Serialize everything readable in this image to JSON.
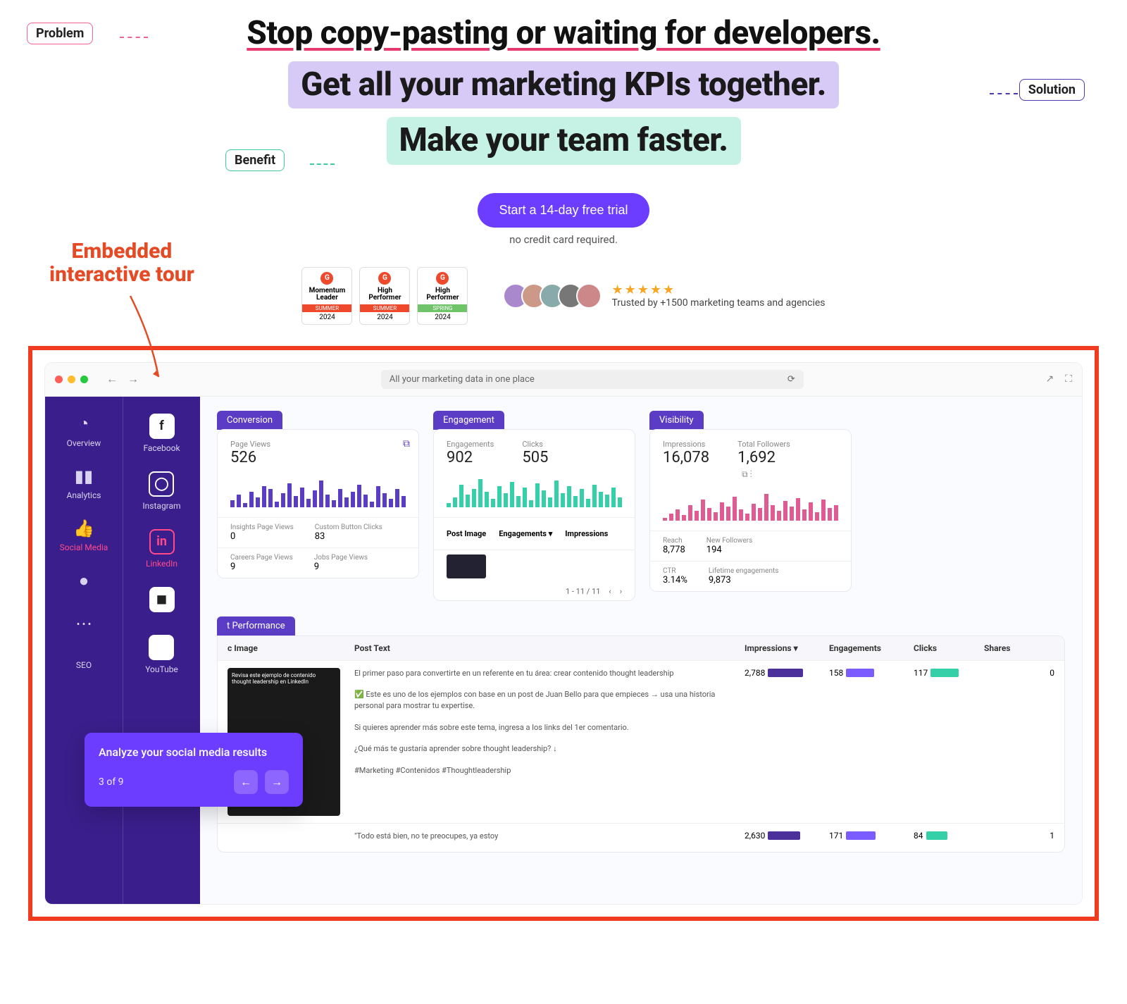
{
  "tags": {
    "problem": "Problem",
    "solution": "Solution",
    "benefit": "Benefit"
  },
  "headline": {
    "line1": "Stop copy-pasting or waiting for developers.",
    "line2": "Get all your marketing KPIs together.",
    "line3": "Make your team faster."
  },
  "cta": {
    "button": "Start a 14-day free trial",
    "sub": "no credit card required."
  },
  "annotation": "Embedded\ninteractive tour",
  "badges": [
    {
      "title": "Momentum Leader",
      "season": "SUMMER",
      "year": "2024",
      "variant": "summer"
    },
    {
      "title": "High Performer",
      "season": "SUMMER",
      "year": "2024",
      "variant": "summer"
    },
    {
      "title": "High Performer",
      "season": "SPRING",
      "year": "2024",
      "variant": "spring"
    }
  ],
  "trusted": {
    "stars": "★★★★★",
    "text": "Trusted by +1500 marketing teams and agencies"
  },
  "browser": {
    "title": "All your marketing data in one place"
  },
  "sidebar1": [
    {
      "icon": "◔",
      "label": "Overview",
      "name": "overview"
    },
    {
      "icon": "▮▮",
      "label": "Analytics",
      "name": "analytics"
    },
    {
      "icon": "👍",
      "label": "Social Media",
      "name": "social-media",
      "pink": true
    },
    {
      "icon": "●",
      "label": "",
      "name": "dot1"
    },
    {
      "icon": "⋯",
      "label": "",
      "name": "dot2"
    },
    {
      "icon": "",
      "label": "SEO",
      "name": "seo"
    }
  ],
  "sidebar2": [
    {
      "glyph": "f",
      "label": "Facebook",
      "name": "facebook"
    },
    {
      "glyph": "◯",
      "label": "Instagram",
      "name": "instagram",
      "outline": true
    },
    {
      "glyph": "in",
      "label": "LinkedIn",
      "name": "linkedin",
      "pink": true
    },
    {
      "glyph": "◼",
      "label": "",
      "name": "twitter"
    },
    {
      "glyph": "",
      "label": "YouTube",
      "name": "youtube"
    }
  ],
  "cards": {
    "conversion": {
      "tab": "Conversion",
      "kpis": [
        {
          "label": "Page Views",
          "value": "526"
        }
      ],
      "bars": [
        10,
        18,
        6,
        22,
        14,
        30,
        26,
        8,
        20,
        34,
        16,
        28,
        12,
        24,
        38,
        18,
        10,
        26,
        14,
        22,
        32,
        18,
        8,
        30,
        20,
        12,
        26,
        16
      ],
      "rows": [
        [
          {
            "l": "Insights Page Views",
            "v": "0"
          },
          {
            "l": "Custom Button Clicks",
            "v": "83"
          }
        ],
        [
          {
            "l": "Careers Page Views",
            "v": "9"
          },
          {
            "l": "Jobs Page Views",
            "v": "9"
          }
        ]
      ]
    },
    "engagement": {
      "tab": "Engagement",
      "kpis": [
        {
          "label": "Engagements",
          "value": "902"
        },
        {
          "label": "Clicks",
          "value": "505"
        }
      ],
      "bars": [
        6,
        14,
        32,
        18,
        26,
        40,
        22,
        12,
        30,
        20,
        36,
        16,
        28,
        10,
        34,
        24,
        14,
        38,
        20,
        30,
        16,
        26,
        12,
        32,
        22,
        18,
        28,
        14
      ],
      "header": [
        "Post Image",
        "Engagements ▾",
        "Impressions"
      ],
      "pager": "1 - 11 / 11"
    },
    "visibility": {
      "tab": "Visibility",
      "kpis": [
        {
          "label": "Impressions",
          "value": "16,078"
        },
        {
          "label": "Total Followers",
          "value": "1,692"
        }
      ],
      "bars": [
        4,
        10,
        16,
        8,
        22,
        14,
        30,
        18,
        12,
        26,
        20,
        34,
        16,
        10,
        24,
        18,
        38,
        22,
        14,
        28,
        20,
        32,
        16,
        26,
        12,
        30,
        18,
        22
      ],
      "rows": [
        [
          {
            "l": "Reach",
            "v": "8,778"
          },
          {
            "l": "New Followers",
            "v": "194"
          }
        ],
        [
          {
            "l": "CTR",
            "v": "3.14%"
          },
          {
            "l": "Lifetime engagements",
            "v": "9,873"
          }
        ]
      ]
    }
  },
  "postPerf": {
    "tab": "t Performance",
    "columns": [
      "c Image",
      "Post Text",
      "Impressions ▾",
      "Engagements",
      "Clicks",
      "Shares"
    ],
    "rows": [
      {
        "imgTitle": "Revisa este ejemplo de contenido thought leadership en LinkedIn",
        "text": "El primer paso para convertirte en un referente en tu área: crear contenido thought leadership\n\n✅ Este es uno de los ejemplos con base en un post de Juan Bello para que empieces → usa una historia personal para mostrar tu expertise.\n\nSi quieres aprender más sobre este tema, ingresa a los links del 1er comentario.\n\n¿Qué más te gustaría aprender sobre thought leadership? ↓\n\n#Marketing #Contenidos #Thoughtleadership",
        "impressions": "2,788",
        "engagements": "158",
        "clicks": "117",
        "shares": "0"
      },
      {
        "imgTitle": "",
        "text": "\"Todo está bien, no te preocupes, ya estoy",
        "impressions": "2,630",
        "engagements": "171",
        "clicks": "84",
        "shares": "1"
      }
    ]
  },
  "tour": {
    "title": "Analyze your social media results",
    "step": "3 of 9"
  }
}
